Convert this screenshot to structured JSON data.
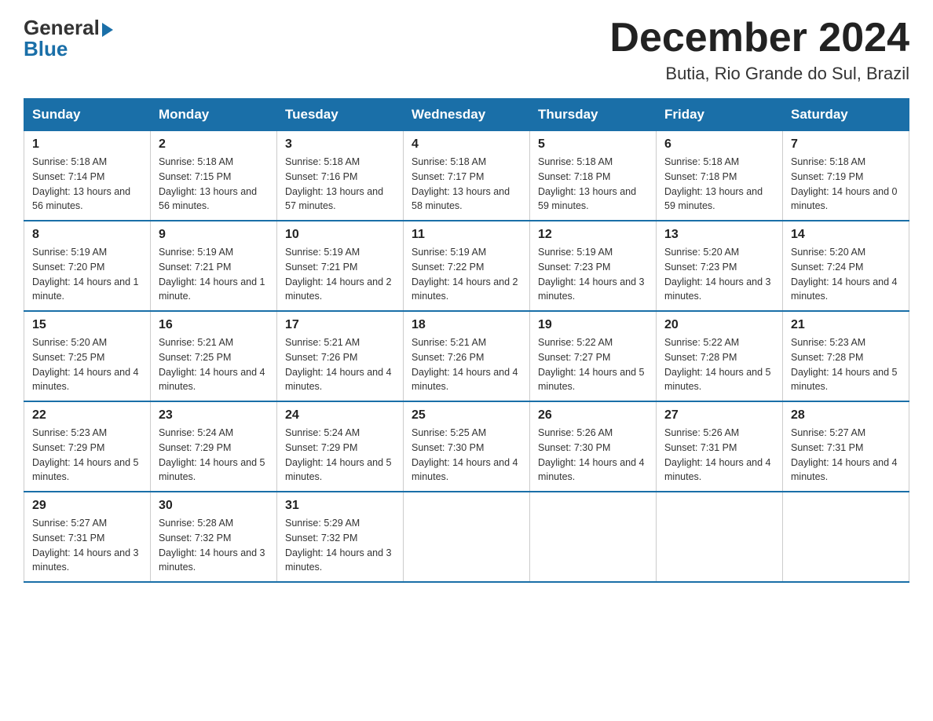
{
  "header": {
    "logo_general": "General",
    "logo_blue": "Blue",
    "month_title": "December 2024",
    "location": "Butia, Rio Grande do Sul, Brazil"
  },
  "weekdays": [
    "Sunday",
    "Monday",
    "Tuesday",
    "Wednesday",
    "Thursday",
    "Friday",
    "Saturday"
  ],
  "weeks": [
    [
      {
        "day": "1",
        "sunrise": "5:18 AM",
        "sunset": "7:14 PM",
        "daylight": "13 hours and 56 minutes."
      },
      {
        "day": "2",
        "sunrise": "5:18 AM",
        "sunset": "7:15 PM",
        "daylight": "13 hours and 56 minutes."
      },
      {
        "day": "3",
        "sunrise": "5:18 AM",
        "sunset": "7:16 PM",
        "daylight": "13 hours and 57 minutes."
      },
      {
        "day": "4",
        "sunrise": "5:18 AM",
        "sunset": "7:17 PM",
        "daylight": "13 hours and 58 minutes."
      },
      {
        "day": "5",
        "sunrise": "5:18 AM",
        "sunset": "7:18 PM",
        "daylight": "13 hours and 59 minutes."
      },
      {
        "day": "6",
        "sunrise": "5:18 AM",
        "sunset": "7:18 PM",
        "daylight": "13 hours and 59 minutes."
      },
      {
        "day": "7",
        "sunrise": "5:18 AM",
        "sunset": "7:19 PM",
        "daylight": "14 hours and 0 minutes."
      }
    ],
    [
      {
        "day": "8",
        "sunrise": "5:19 AM",
        "sunset": "7:20 PM",
        "daylight": "14 hours and 1 minute."
      },
      {
        "day": "9",
        "sunrise": "5:19 AM",
        "sunset": "7:21 PM",
        "daylight": "14 hours and 1 minute."
      },
      {
        "day": "10",
        "sunrise": "5:19 AM",
        "sunset": "7:21 PM",
        "daylight": "14 hours and 2 minutes."
      },
      {
        "day": "11",
        "sunrise": "5:19 AM",
        "sunset": "7:22 PM",
        "daylight": "14 hours and 2 minutes."
      },
      {
        "day": "12",
        "sunrise": "5:19 AM",
        "sunset": "7:23 PM",
        "daylight": "14 hours and 3 minutes."
      },
      {
        "day": "13",
        "sunrise": "5:20 AM",
        "sunset": "7:23 PM",
        "daylight": "14 hours and 3 minutes."
      },
      {
        "day": "14",
        "sunrise": "5:20 AM",
        "sunset": "7:24 PM",
        "daylight": "14 hours and 4 minutes."
      }
    ],
    [
      {
        "day": "15",
        "sunrise": "5:20 AM",
        "sunset": "7:25 PM",
        "daylight": "14 hours and 4 minutes."
      },
      {
        "day": "16",
        "sunrise": "5:21 AM",
        "sunset": "7:25 PM",
        "daylight": "14 hours and 4 minutes."
      },
      {
        "day": "17",
        "sunrise": "5:21 AM",
        "sunset": "7:26 PM",
        "daylight": "14 hours and 4 minutes."
      },
      {
        "day": "18",
        "sunrise": "5:21 AM",
        "sunset": "7:26 PM",
        "daylight": "14 hours and 4 minutes."
      },
      {
        "day": "19",
        "sunrise": "5:22 AM",
        "sunset": "7:27 PM",
        "daylight": "14 hours and 5 minutes."
      },
      {
        "day": "20",
        "sunrise": "5:22 AM",
        "sunset": "7:28 PM",
        "daylight": "14 hours and 5 minutes."
      },
      {
        "day": "21",
        "sunrise": "5:23 AM",
        "sunset": "7:28 PM",
        "daylight": "14 hours and 5 minutes."
      }
    ],
    [
      {
        "day": "22",
        "sunrise": "5:23 AM",
        "sunset": "7:29 PM",
        "daylight": "14 hours and 5 minutes."
      },
      {
        "day": "23",
        "sunrise": "5:24 AM",
        "sunset": "7:29 PM",
        "daylight": "14 hours and 5 minutes."
      },
      {
        "day": "24",
        "sunrise": "5:24 AM",
        "sunset": "7:29 PM",
        "daylight": "14 hours and 5 minutes."
      },
      {
        "day": "25",
        "sunrise": "5:25 AM",
        "sunset": "7:30 PM",
        "daylight": "14 hours and 4 minutes."
      },
      {
        "day": "26",
        "sunrise": "5:26 AM",
        "sunset": "7:30 PM",
        "daylight": "14 hours and 4 minutes."
      },
      {
        "day": "27",
        "sunrise": "5:26 AM",
        "sunset": "7:31 PM",
        "daylight": "14 hours and 4 minutes."
      },
      {
        "day": "28",
        "sunrise": "5:27 AM",
        "sunset": "7:31 PM",
        "daylight": "14 hours and 4 minutes."
      }
    ],
    [
      {
        "day": "29",
        "sunrise": "5:27 AM",
        "sunset": "7:31 PM",
        "daylight": "14 hours and 3 minutes."
      },
      {
        "day": "30",
        "sunrise": "5:28 AM",
        "sunset": "7:32 PM",
        "daylight": "14 hours and 3 minutes."
      },
      {
        "day": "31",
        "sunrise": "5:29 AM",
        "sunset": "7:32 PM",
        "daylight": "14 hours and 3 minutes."
      },
      null,
      null,
      null,
      null
    ]
  ]
}
